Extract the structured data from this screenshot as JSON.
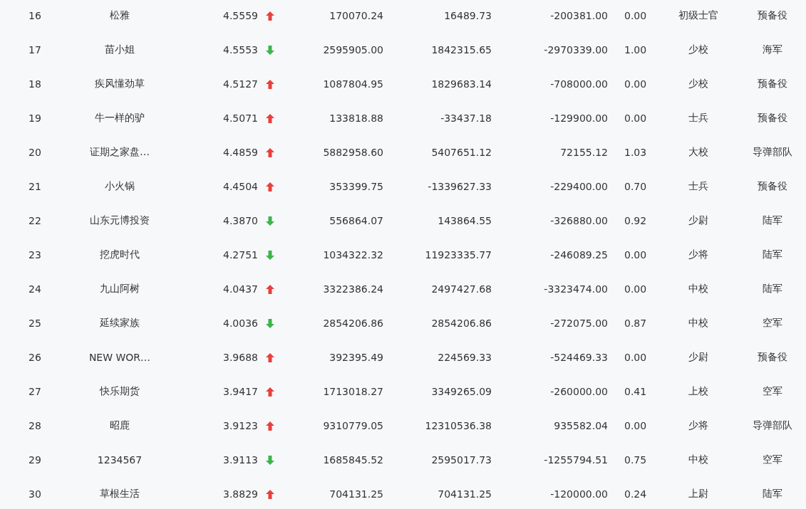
{
  "rows": [
    {
      "rank": "16",
      "name": "松雅",
      "score": "4.5559",
      "rising": true,
      "column_4": "170070.24",
      "column_5": "16489.73",
      "column_6": "-200381.00",
      "column_7": "0.00",
      "column_8": "初级士官",
      "column_9": "预备役"
    },
    {
      "rank": "17",
      "name": "苗小姐",
      "score": "4.5553",
      "rising": false,
      "column_4": "2595905.00",
      "column_5": "1842315.65",
      "column_6": "-2970339.00",
      "column_7": "1.00",
      "column_8": "少校",
      "column_9": "海军"
    },
    {
      "rank": "18",
      "name": "疾风懂劲草",
      "score": "4.5127",
      "rising": true,
      "column_4": "1087804.95",
      "column_5": "1829683.14",
      "column_6": "-708000.00",
      "column_7": "0.00",
      "column_8": "少校",
      "column_9": "预备役"
    },
    {
      "rank": "19",
      "name": "牛一样的驴",
      "score": "4.5071",
      "rising": true,
      "column_4": "133818.88",
      "column_5": "-33437.18",
      "column_6": "-129900.00",
      "column_7": "0.00",
      "column_8": "士兵",
      "column_9": "预备役"
    },
    {
      "rank": "20",
      "name": "证期之家盘…",
      "score": "4.4859",
      "rising": true,
      "column_4": "5882958.60",
      "column_5": "5407651.12",
      "column_6": "72155.12",
      "column_7": "1.03",
      "column_8": "大校",
      "column_9": "导弹部队"
    },
    {
      "rank": "21",
      "name": "小火锅",
      "score": "4.4504",
      "rising": true,
      "column_4": "353399.75",
      "column_5": "-1339627.33",
      "column_6": "-229400.00",
      "column_7": "0.70",
      "column_8": "士兵",
      "column_9": "预备役"
    },
    {
      "rank": "22",
      "name": "山东元博投资",
      "score": "4.3870",
      "rising": false,
      "column_4": "556864.07",
      "column_5": "143864.55",
      "column_6": "-326880.00",
      "column_7": "0.92",
      "column_8": "少尉",
      "column_9": "陆军"
    },
    {
      "rank": "23",
      "name": "挖虎时代",
      "score": "4.2751",
      "rising": false,
      "column_4": "1034322.32",
      "column_5": "11923335.77",
      "column_6": "-246089.25",
      "column_7": "0.00",
      "column_8": "少将",
      "column_9": "陆军"
    },
    {
      "rank": "24",
      "name": "九山阿树",
      "score": "4.0437",
      "rising": true,
      "column_4": "3322386.24",
      "column_5": "2497427.68",
      "column_6": "-3323474.00",
      "column_7": "0.00",
      "column_8": "中校",
      "column_9": "陆军"
    },
    {
      "rank": "25",
      "name": "延续家族",
      "score": "4.0036",
      "rising": false,
      "column_4": "2854206.86",
      "column_5": "2854206.86",
      "column_6": "-272075.00",
      "column_7": "0.87",
      "column_8": "中校",
      "column_9": "空军"
    },
    {
      "rank": "26",
      "name": "NEW WOR…",
      "score": "3.9688",
      "rising": true,
      "column_4": "392395.49",
      "column_5": "224569.33",
      "column_6": "-524469.33",
      "column_7": "0.00",
      "column_8": "少尉",
      "column_9": "预备役"
    },
    {
      "rank": "27",
      "name": "快乐期货",
      "score": "3.9417",
      "rising": true,
      "column_4": "1713018.27",
      "column_5": "3349265.09",
      "column_6": "-260000.00",
      "column_7": "0.41",
      "column_8": "上校",
      "column_9": "空军"
    },
    {
      "rank": "28",
      "name": "昭鹿",
      "score": "3.9123",
      "rising": true,
      "column_4": "9310779.05",
      "column_5": "12310536.38",
      "column_6": "935582.04",
      "column_7": "0.00",
      "column_8": "少将",
      "column_9": "导弹部队"
    },
    {
      "rank": "29",
      "name": "1234567",
      "score": "3.9113",
      "rising": false,
      "column_4": "1685845.52",
      "column_5": "2595017.73",
      "column_6": "-1255794.51",
      "column_7": "0.75",
      "column_8": "中校",
      "column_9": "空军"
    },
    {
      "rank": "30",
      "name": "草根生活",
      "score": "3.8829",
      "rising": true,
      "column_4": "704131.25",
      "column_5": "704131.25",
      "column_6": "-120000.00",
      "column_7": "0.24",
      "column_8": "上尉",
      "column_9": "陆军"
    }
  ]
}
